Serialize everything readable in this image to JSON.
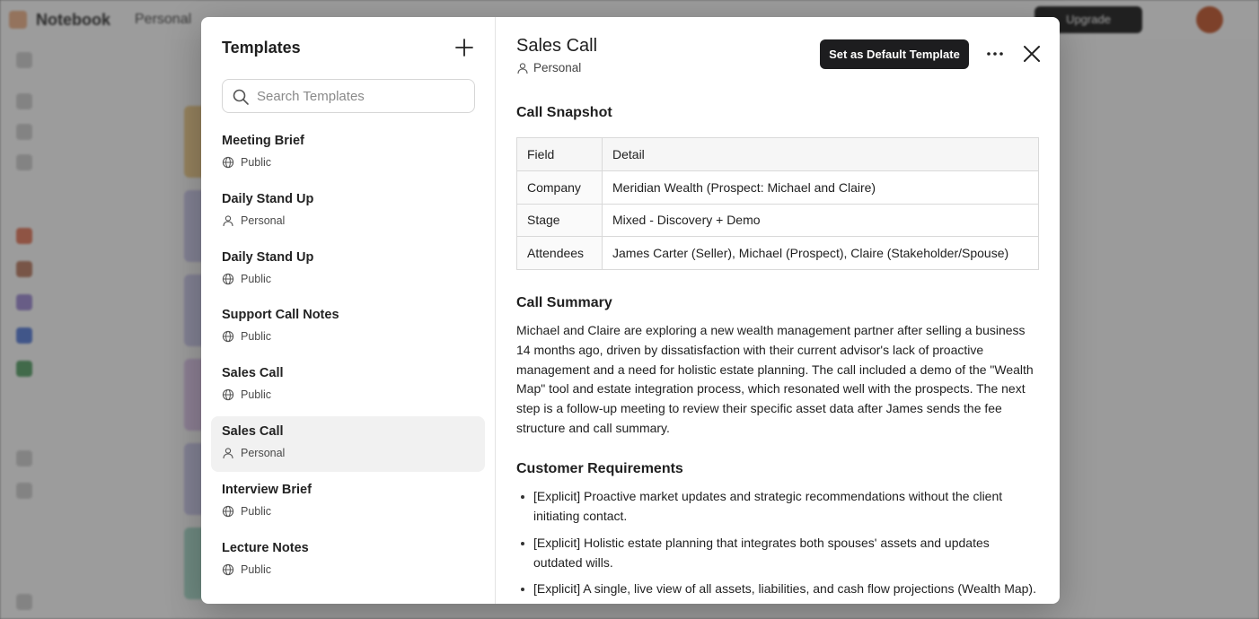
{
  "background": {
    "app_name": "Notebook",
    "breadcrumb": "Personal",
    "upgrade_label": "Upgrade"
  },
  "templates_panel": {
    "title": "Templates",
    "search_placeholder": "Search Templates",
    "items": [
      {
        "name": "Meeting Brief",
        "scope": "Public",
        "scope_icon": "globe-icon"
      },
      {
        "name": "Daily Stand Up",
        "scope": "Personal",
        "scope_icon": "person-icon"
      },
      {
        "name": "Daily Stand Up",
        "scope": "Public",
        "scope_icon": "globe-icon"
      },
      {
        "name": "Support Call Notes",
        "scope": "Public",
        "scope_icon": "globe-icon"
      },
      {
        "name": "Sales Call",
        "scope": "Public",
        "scope_icon": "globe-icon"
      },
      {
        "name": "Sales Call",
        "scope": "Personal",
        "scope_icon": "person-icon",
        "selected": true
      },
      {
        "name": "Interview Brief",
        "scope": "Public",
        "scope_icon": "globe-icon"
      },
      {
        "name": "Lecture Notes",
        "scope": "Public",
        "scope_icon": "globe-icon"
      }
    ]
  },
  "detail": {
    "title": "Sales Call",
    "scope": "Personal",
    "default_button": "Set as Default Template",
    "call_snapshot": {
      "heading": "Call Snapshot",
      "header": [
        "Field",
        "Detail"
      ],
      "rows": [
        [
          "Company",
          "Meridian Wealth (Prospect: Michael and Claire)"
        ],
        [
          "Stage",
          "Mixed - Discovery + Demo"
        ],
        [
          "Attendees",
          "James Carter (Seller), Michael (Prospect), Claire (Stakeholder/Spouse)"
        ]
      ]
    },
    "call_summary": {
      "heading": "Call Summary",
      "text": "Michael and Claire are exploring a new wealth management partner after selling a business 14 months ago, driven by dissatisfaction with their current advisor's lack of proactive management and a need for holistic estate planning. The call included a demo of the \"Wealth Map\" tool and estate integration process, which resonated well with the prospects. The next step is a follow-up meeting to review their specific asset data after James sends the fee structure and call summary."
    },
    "customer_requirements": {
      "heading": "Customer Requirements",
      "items": [
        "[Explicit] Proactive market updates and strategic recommendations without the client initiating contact.",
        "[Explicit] Holistic estate planning that integrates both spouses' assets and updates outdated wills.",
        "[Explicit] A single, live view of all assets, liabilities, and cash flow projections (Wealth Map)."
      ]
    }
  },
  "colors": {
    "button_bg": "#1d1d1f",
    "selected_row": "#f1f1f1",
    "scrim": "rgba(30,30,30,0.42)"
  }
}
